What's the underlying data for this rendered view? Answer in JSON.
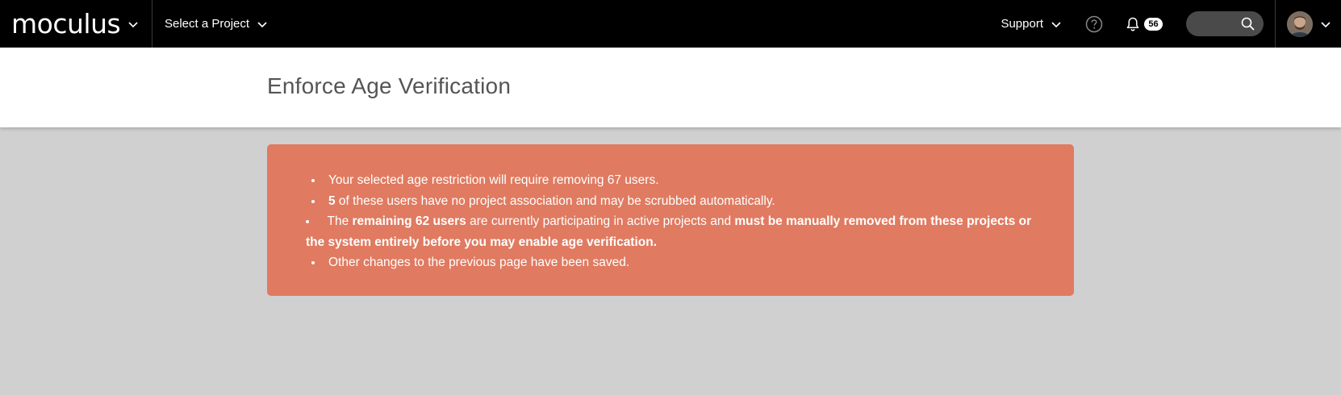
{
  "nav": {
    "brand": "moculus",
    "project_select": "Select a Project",
    "support": "Support",
    "notifications_count": "56",
    "search": {
      "placeholder": ""
    }
  },
  "page": {
    "title": "Enforce Age Verification"
  },
  "alert": {
    "color": "#e07a60",
    "item1": "Your selected age restriction will require removing 67 users.",
    "item2_bold": "5",
    "item2_rest": " of these users have no project association and may be scrubbed automatically.",
    "item3_pre": "The ",
    "item3_bold1": "remaining 62 users",
    "item3_mid": " are currently participating in active projects and ",
    "item3_bold2": "must be manually removed from these projects or the system entirely before you may enable age verification.",
    "item4": "Other changes to the previous page have been saved."
  }
}
